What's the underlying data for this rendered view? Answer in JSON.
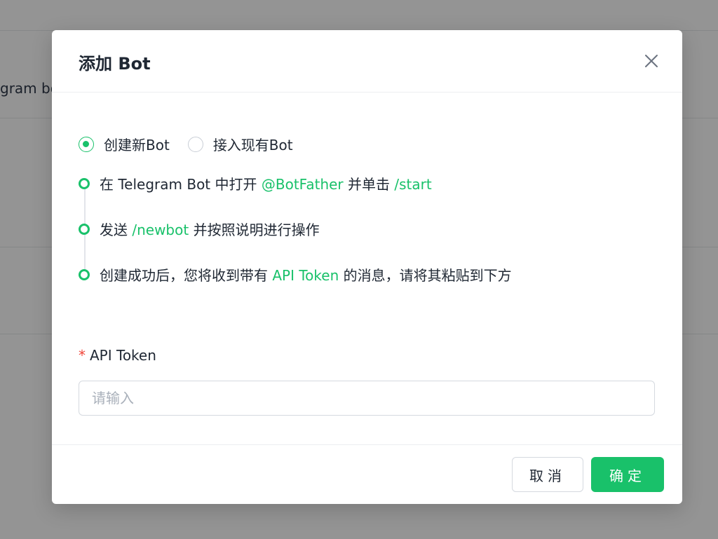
{
  "background": {
    "partial_text": "gram bo"
  },
  "modal": {
    "title": "添加 Bot",
    "close_icon": "close-icon",
    "radio_options": [
      {
        "label": "创建新Bot",
        "checked": true
      },
      {
        "label": "接入现有Bot",
        "checked": false
      }
    ],
    "steps": [
      {
        "parts": [
          "在 Telegram Bot 中打开 ",
          "@BotFather",
          " 并单击 ",
          "/start"
        ]
      },
      {
        "parts": [
          "发送 ",
          "/newbot",
          " 并按照说明进行操作"
        ]
      },
      {
        "parts": [
          "创建成功后，您将收到带有 ",
          "API Token",
          " 的消息，请将其粘贴到下方"
        ]
      }
    ],
    "field": {
      "required_mark": "*",
      "label": "API Token",
      "value": "",
      "placeholder": "请输入"
    },
    "footer": {
      "cancel_label": "取消",
      "ok_label": "确定"
    }
  },
  "colors": {
    "accent": "#19c16a",
    "required": "#f04438",
    "overlay": "rgba(0,0,0,0.42)"
  }
}
